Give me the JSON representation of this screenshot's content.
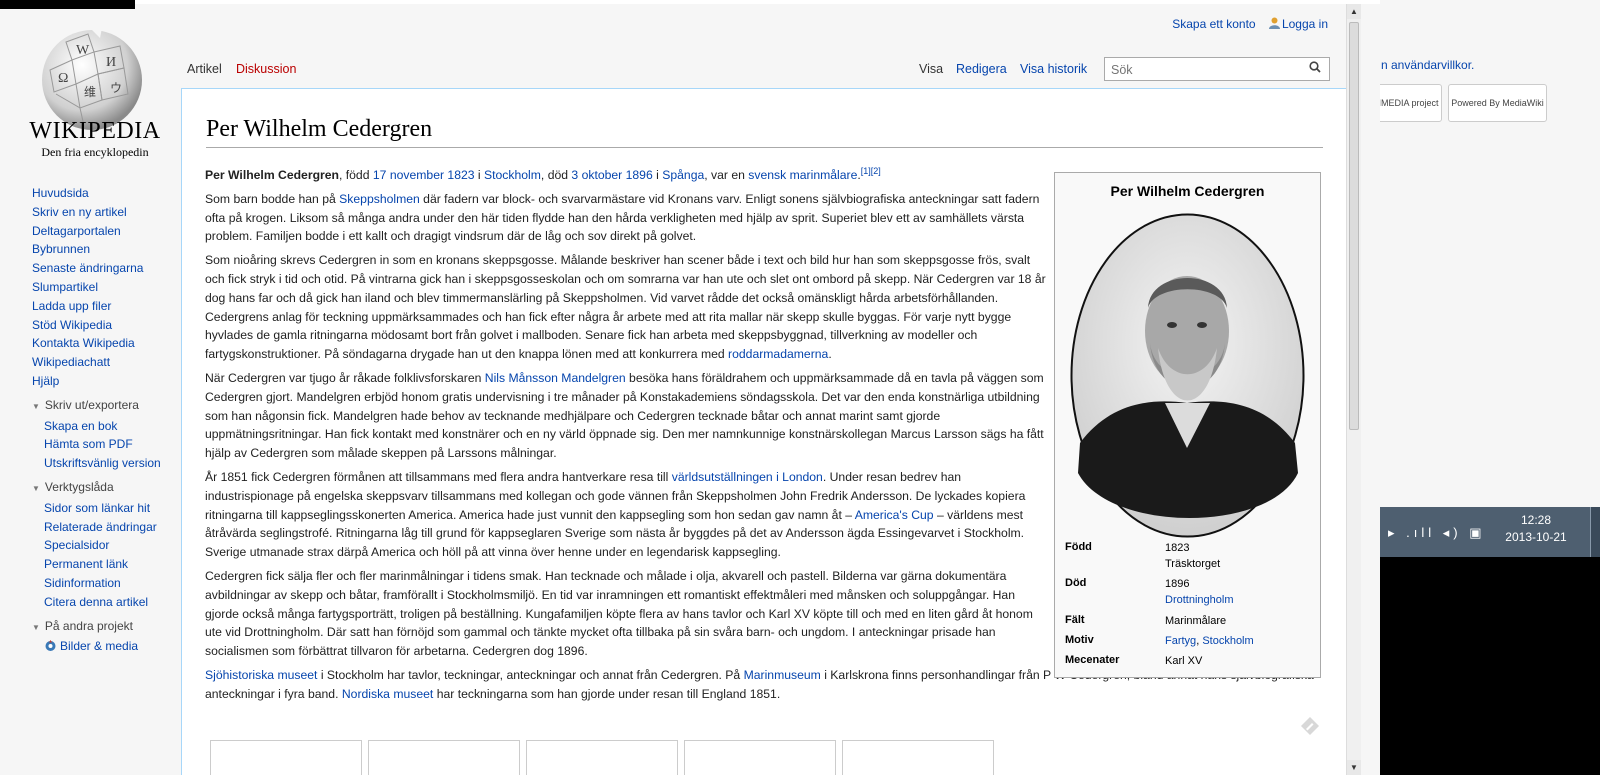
{
  "background": {
    "terms_text": "n användarvillkor.",
    "badges": {
      "wikimedia": "WIKIMEDIA project",
      "mediawiki": "Powered By MediaWiki"
    },
    "taskbar": {
      "tray_icons": "▸ .ıll ◂) ▣",
      "time": "12:28",
      "date": "2013-10-21"
    }
  },
  "logo": {
    "wordmark": "WIKIPEDIA",
    "tagline": "Den fria encyklopedin"
  },
  "nav": {
    "main": [
      "Huvudsida",
      "Skriv en ny artikel",
      "Deltagarportalen",
      "Bybrunnen",
      "Senaste ändringarna",
      "Slumpartikel",
      "Ladda upp filer",
      "Stöd Wikipedia",
      "Kontakta Wikipedia",
      "Wikipediachatt",
      "Hjälp"
    ],
    "print": {
      "heading": "Skriv ut/exportera",
      "items": [
        "Skapa en bok",
        "Hämta som PDF",
        "Utskriftsvänlig version"
      ]
    },
    "tools": {
      "heading": "Verktygslåda",
      "items": [
        "Sidor som länkar hit",
        "Relaterade ändringar",
        "Specialsidor",
        "Permanent länk",
        "Sidinformation",
        "Citera denna artikel"
      ]
    },
    "other": {
      "heading": "På andra projekt",
      "items": [
        "Bilder & media"
      ]
    }
  },
  "personal": {
    "create_account": "Skapa ett konto",
    "login": "Logga in"
  },
  "tabs": {
    "article": "Artikel",
    "talk": "Diskussion",
    "read": "Visa",
    "edit": "Redigera",
    "history": "Visa historik"
  },
  "search": {
    "placeholder": "Sök"
  },
  "article": {
    "title": "Per Wilhelm Cedergren",
    "lead": {
      "name": "Per Wilhelm Cedergren",
      "t1": ", född ",
      "born": "17 november 1823",
      "t2": " i ",
      "born_place": "Stockholm",
      "t3": ", död ",
      "died": "3 oktober 1896",
      "t4": " i ",
      "died_place": "Spånga",
      "t5": ", var en ",
      "nationality": "svensk",
      "t6": " ",
      "occupation": "marinmålare",
      "t7": ".",
      "refs": "[1][2]"
    },
    "p1": {
      "a": "Som barn bodde han på ",
      "link": "Skeppsholmen",
      "b": " där fadern var block- och svarvarmästare vid Kronans varv. Enligt sonens självbiografiska anteckningar satt fadern ofta på krogen. Liksom så många andra under den här tiden flydde han den hårda verkligheten med hjälp av sprit. Superiet blev ett av samhällets värsta problem. Familjen bodde i ett kallt och dragigt vindsrum där de låg och sov direkt på golvet."
    },
    "p2": {
      "a": "Som nioåring skrevs Cedergren in som en kronans skeppsgosse. Målande beskriver han scener både i text och bild hur han som skeppsgosse frös, svalt och fick stryk i tid och otid. På vintrarna gick han i skeppsgosseskolan och om somrarna var han ute och slet ont ombord på skepp. När Cedergren var 18 år dog hans far och då gick han iland och blev timmermanslärling på Skeppsholmen. Vid varvet rådde det också omänskligt hårda arbetsförhållanden. Cedergrens anlag för teckning uppmärksammades och han fick efter några år arbete med att rita mallar när skepp skulle byggas. För varje nytt bygge hyvlades de gamla ritningarna mödosamt bort från golvet i mallboden. Senare fick han arbeta med skeppsbyggnad, tillverkning av modeller och fartygskonstruktioner. På söndagarna drygade han ut den knappa lönen med att konkurrera med ",
      "link": "roddarmadamerna",
      "b": "."
    },
    "p3": {
      "a": "När Cedergren var tjugo år råkade folklivsforskaren ",
      "link": "Nils Månsson Mandelgren",
      "b": " besöka hans föräldrahem och uppmärksammade då en tavla på väggen som Cedergren gjort. Mandelgren erbjöd honom gratis undervisning i tre månader på Konstakademiens söndagsskola. Det var den enda konstnärliga utbildning som han någonsin fick. Mandelgren hade behov av tecknande medhjälpare och Cedergren tecknade båtar och annat marint samt gjorde uppmätningsritningar. Han fick kontakt med konstnärer och en ny värld öppnade sig. Den mer namnkunnige konstnärskollegan Marcus Larsson sägs ha fått hjälp av Cedergren som målade skeppen på Larssons målningar."
    },
    "p4": {
      "a": "År 1851 fick Cedergren förmånen att tillsammans med flera andra hantverkare resa till ",
      "link": "världsutställningen i London",
      "b": ". Under resan bedrev han industrispionage på engelska skeppsvarv tillsammans med kollegan och gode vännen från Skeppsholmen John Fredrik Andersson. De lyckades kopiera ritningarna till kappseglingsskonerten America. America hade just vunnit den kappsegling som hon sedan gav namn åt – ",
      "link2": "America's Cup",
      "c": " – världens mest åtråvärda seglingstrofé. Ritningarna låg till grund för kappseglaren Sverige som nästa år byggdes på det av Andersson ägda Essingevarvet i Stockholm. Sverige utmanade strax därpå America och höll på att vinna över henne under en legendarisk kappsegling."
    },
    "p5": {
      "a": "Cedergren fick sälja fler och fler marinmålningar i tidens smak. Han tecknade och målade i olja, akvarell och pastell. Bilderna var gärna dokumentära avbildningar av skepp och båtar, framförallt i Stockholmsmiljö. En tid var inramningen ett romantiskt effektmåleri med månsken och soluppgångar. Han gjorde också många fartygsporträtt, troligen på beställning. Kungafamiljen köpte flera av hans tavlor och Karl XV köpte till och med en liten gård åt honom ute vid Drottningholm. Där satt han förnöjd som gammal och tänkte mycket ofta tillbaka på sin svåra barn- och ungdom. I anteckningar prisade han socialismen som förbättrat tillvaron för arbetarna. Cedergren dog 1896."
    },
    "p6": {
      "link": "Sjöhistoriska museet",
      "a": " i Stockholm har tavlor, teckningar, anteckningar och annat från Cedergren. På ",
      "link2": "Marinmuseum",
      "b": " i Karlskrona finns personhandlingar från P W Cedergren, bland annat hans självbiografiska anteckningar i fyra band. ",
      "link3": "Nordiska museet",
      "c": " har teckningarna som han gjorde under resan till England 1851."
    }
  },
  "infobox": {
    "title": "Per Wilhelm Cedergren",
    "born_label": "Född",
    "born_year": "1823",
    "born_place": "Träsktorget",
    "died_label": "Död",
    "died_year": "1896",
    "died_place": "Drottningholm",
    "field_label": "Fält",
    "field_value": "Marinmålare",
    "motif_label": "Motiv",
    "motif_a": "Fartyg",
    "motif_sep": ", ",
    "motif_b": "Stockholm",
    "patron_label": "Mecenater",
    "patron_value": "Karl XV"
  }
}
